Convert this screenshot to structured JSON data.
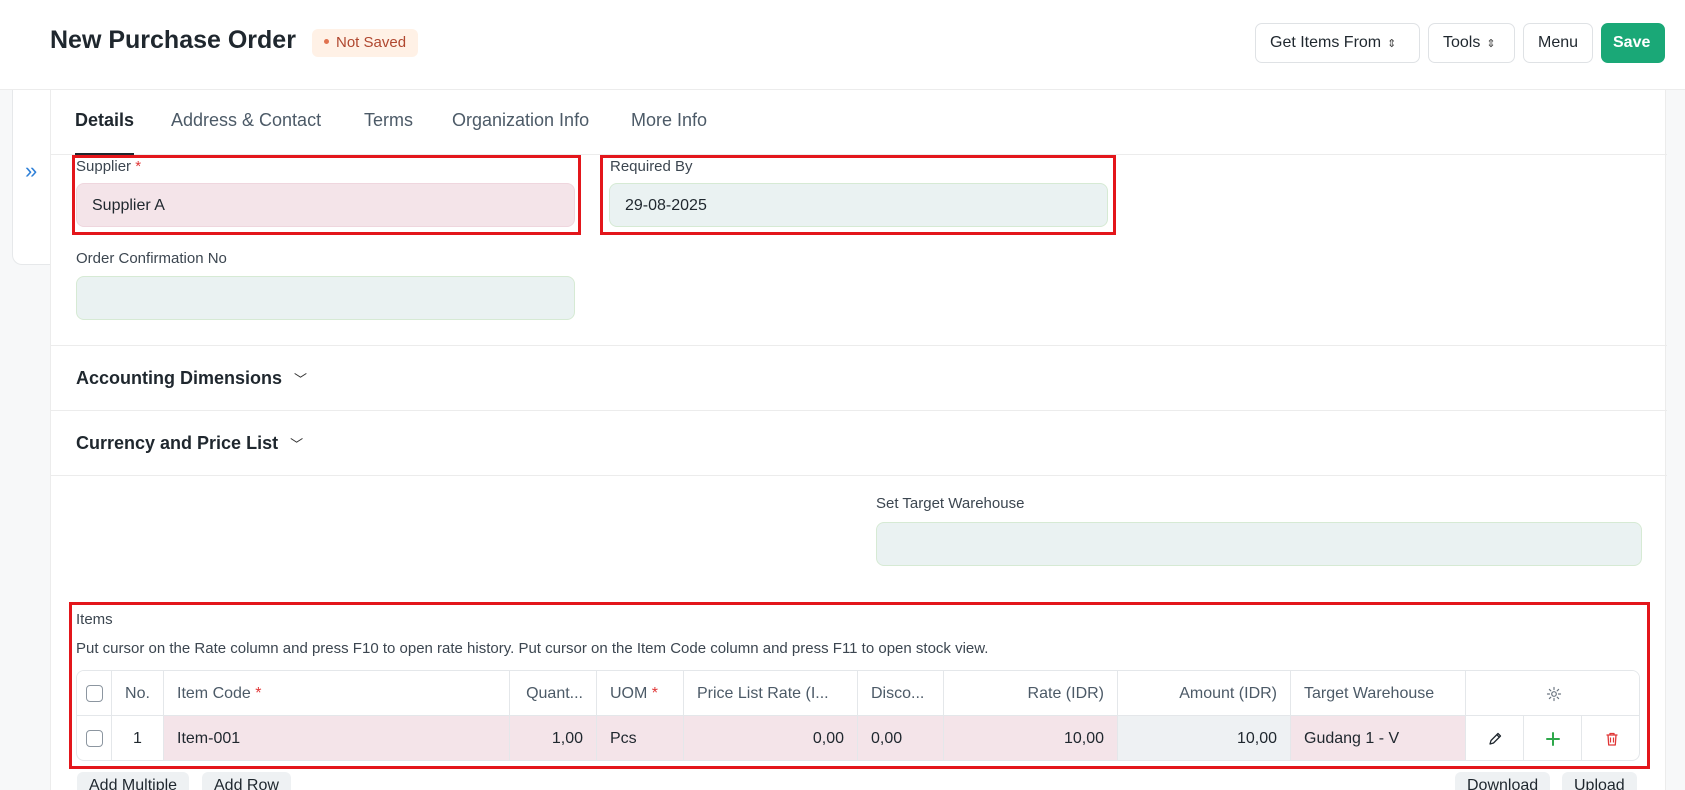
{
  "header": {
    "title": "New Purchase Order",
    "status": "Not Saved",
    "buttons": {
      "get_items": "Get Items From",
      "tools": "Tools",
      "menu": "Menu",
      "save": "Save"
    }
  },
  "tabs": [
    {
      "label": "Details",
      "active": true
    },
    {
      "label": "Address & Contact"
    },
    {
      "label": "Terms"
    },
    {
      "label": "Organization Info"
    },
    {
      "label": "More Info"
    }
  ],
  "fields": {
    "supplier": {
      "label": "Supplier",
      "required_mark": "*",
      "value": "Supplier A"
    },
    "required_by": {
      "label": "Required By",
      "value": "29-08-2025"
    },
    "order_confirmation_no": {
      "label": "Order Confirmation No",
      "value": ""
    },
    "set_target_warehouse": {
      "label": "Set Target Warehouse",
      "value": ""
    }
  },
  "sections": {
    "accounting_dimensions": "Accounting Dimensions",
    "currency_price_list": "Currency and Price List"
  },
  "items": {
    "label": "Items",
    "description": "Put cursor on the Rate column and press F10 to open rate history. Put cursor on the Item Code column and press F11 to open stock view.",
    "columns": {
      "no": "No.",
      "item_code": "Item Code",
      "quantity": "Quant...",
      "uom": "UOM",
      "price_list_rate": "Price List Rate (I...",
      "discount": "Disco...",
      "rate": "Rate (IDR)",
      "amount": "Amount (IDR)",
      "target_warehouse": "Target Warehouse",
      "required_mark": "*"
    },
    "rows": [
      {
        "no": "1",
        "item_code": "Item-001",
        "quantity": "1,00",
        "uom": "Pcs",
        "price_list_rate": "0,00",
        "discount": "0,00",
        "rate": "10,00",
        "amount": "10,00",
        "target_warehouse": "Gudang 1 - V"
      }
    ],
    "buttons": {
      "add_multiple": "Add Multiple",
      "add_row": "Add Row",
      "download": "Download",
      "upload": "Upload"
    }
  },
  "colors": {
    "save_green": "#1aa877",
    "highlight_red": "#e3161b",
    "mandatory_bg": "#f4e4e9",
    "input_bg": "#eaf2f2"
  }
}
